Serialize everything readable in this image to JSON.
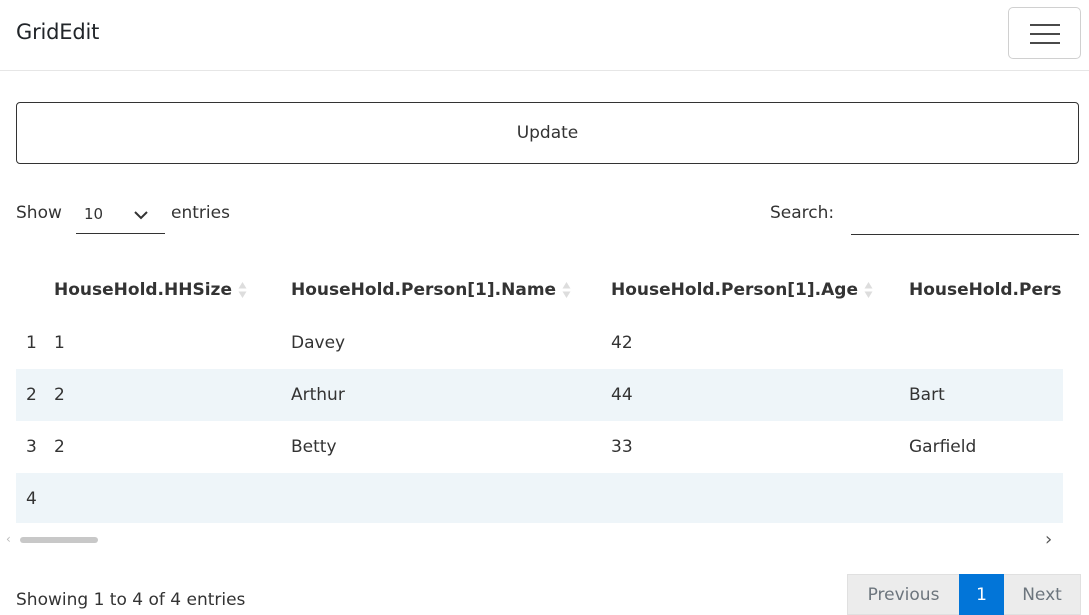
{
  "app": {
    "title": "GridEdit",
    "menu_icon": "hamburger-menu-icon"
  },
  "toolbar": {
    "update_label": "Update"
  },
  "length_menu": {
    "prefix": "Show",
    "selected": "10",
    "suffix": "entries"
  },
  "search": {
    "label": "Search:",
    "value": "",
    "placeholder": ""
  },
  "table": {
    "columns": [
      "",
      "HouseHold.HHSize",
      "HouseHold.Person[1].Name",
      "HouseHold.Person[1].Age",
      "HouseHold.Pers"
    ],
    "rows": [
      [
        "1",
        "1",
        "Davey",
        "42",
        ""
      ],
      [
        "2",
        "2",
        "Arthur",
        "44",
        "Bart"
      ],
      [
        "3",
        "2",
        "Betty",
        "33",
        "Garfield"
      ],
      [
        "4",
        "",
        "",
        "",
        ""
      ]
    ],
    "stripe_color": "#eef5f9"
  },
  "footer": {
    "info": "Showing 1 to 4 of 4 entries"
  },
  "pagination": {
    "previous": "Previous",
    "current": "1",
    "next": "Next",
    "active_color": "#0275d8"
  }
}
